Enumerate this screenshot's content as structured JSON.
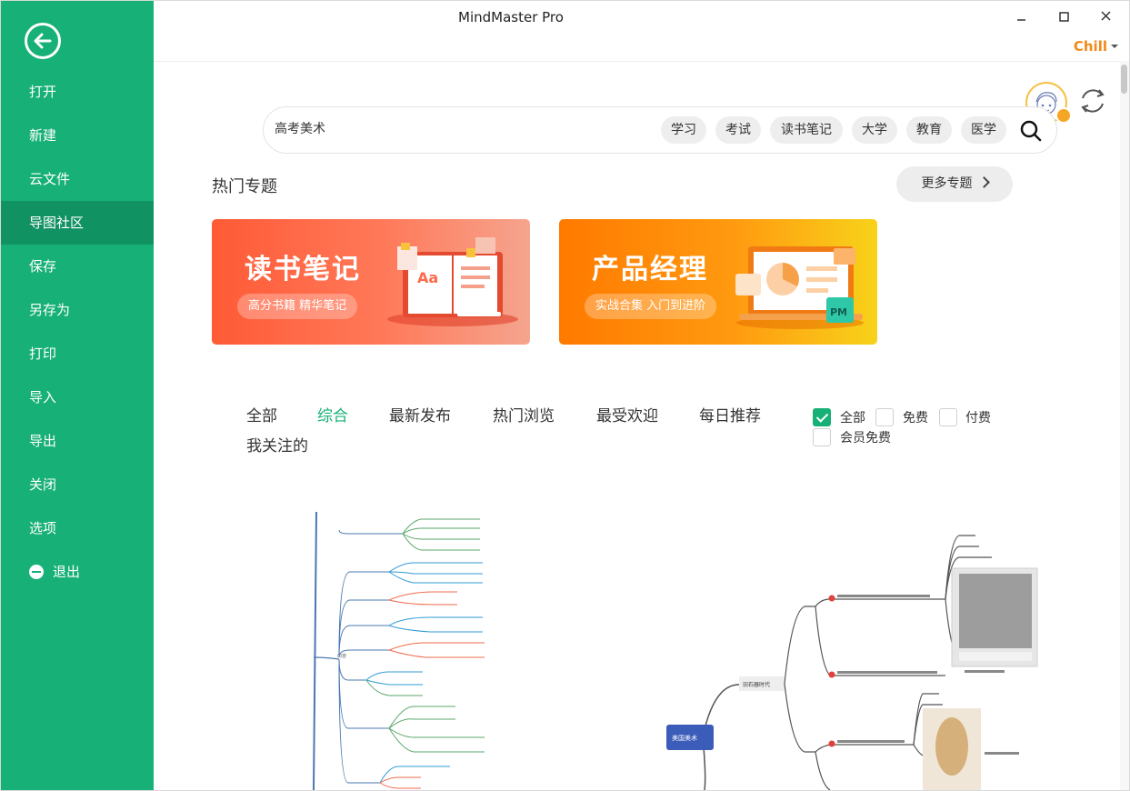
{
  "app": {
    "title": "MindMaster Pro",
    "user": "Chill"
  },
  "sidebar": {
    "items": [
      {
        "label": "打开"
      },
      {
        "label": "新建"
      },
      {
        "label": "云文件"
      },
      {
        "label": "导图社区"
      },
      {
        "label": "保存"
      },
      {
        "label": "另存为"
      },
      {
        "label": "打印"
      },
      {
        "label": "导入"
      },
      {
        "label": "导出"
      },
      {
        "label": "关闭"
      },
      {
        "label": "选项"
      },
      {
        "label": "退出"
      }
    ],
    "active": "导图社区"
  },
  "search": {
    "value": "高考美术",
    "tags": [
      "学习",
      "考试",
      "读书笔记",
      "大学",
      "教育",
      "医学"
    ]
  },
  "hot": {
    "title": "热门专题",
    "more": "更多专题",
    "banners": [
      {
        "title": "读书笔记",
        "subtitle": "高分书籍 精华笔记",
        "badge": "Aa"
      },
      {
        "title": "产品经理",
        "subtitle": "实战合集 入门到进阶",
        "badge": "PM"
      }
    ]
  },
  "tabs": [
    "全部",
    "综合",
    "最新发布",
    "热门浏览",
    "最受欢迎",
    "每日推荐",
    "我关注的"
  ],
  "active_tab": "综合",
  "filters": [
    {
      "label": "全部",
      "checked": true
    },
    {
      "label": "免费",
      "checked": false
    },
    {
      "label": "付费",
      "checked": false
    },
    {
      "label": "会员免费",
      "checked": false
    }
  ],
  "cards": [
    {
      "center_label": "内容"
    },
    {
      "root": "美国美术",
      "branch": "旧石器时代"
    }
  ],
  "colors": {
    "brand": "#17b077",
    "brand_dark": "#119263",
    "user": "#f08a18"
  }
}
